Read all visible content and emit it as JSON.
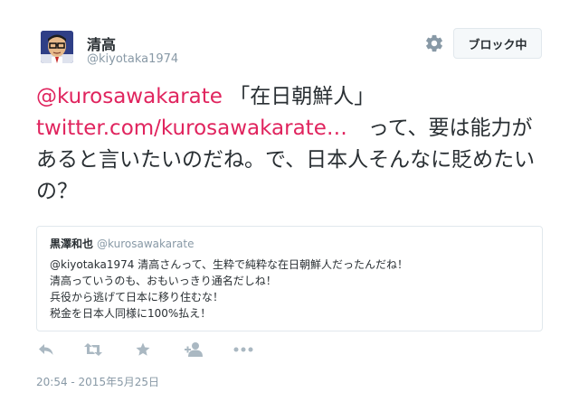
{
  "user": {
    "name": "清高",
    "handle": "@kiyotaka1974"
  },
  "header": {
    "block_button_label": "ブロック中"
  },
  "tweet": {
    "mention": "@kurosawakarate",
    "text1": " 「在日朝鮮人」",
    "url": "twitter.com/kurosawakarate…",
    "text2": "　って、要は能力があると言いたいのだね。で、日本人そんなに貶めたいの？"
  },
  "quoted": {
    "name": "黒澤和也",
    "handle": "@kurosawakarate",
    "lines": [
      "@kiyotaka1974 清高さんって、生粋で純粋な在日朝鮮人だったんだね！",
      "清高っていうのも、おもいっきり通名だしね！",
      "兵役から逃げて日本に移り住むな！",
      "税金を日本人同様に100%払え！"
    ]
  },
  "actions": [
    "reply-icon",
    "retweet-icon",
    "favorite-icon",
    "follow-icon",
    "more-icon"
  ],
  "timestamp": "20:54 - 2015年5月25日",
  "colors": {
    "link": "#e0245e",
    "muted": "#8899a6",
    "text": "#292f33",
    "border": "#e1e8ed",
    "icon": "#aab8c2"
  }
}
